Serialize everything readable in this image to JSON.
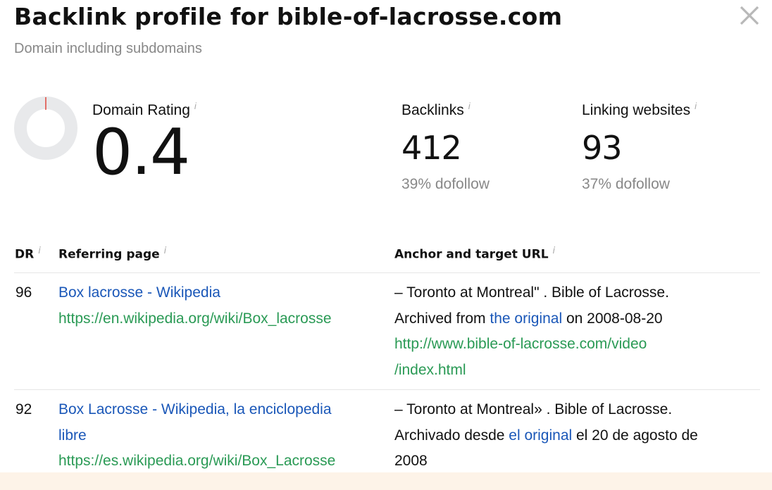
{
  "header": {
    "title": "Backlink profile for bible-of-lacrosse.com",
    "subtitle": "Domain including subdomains",
    "close_icon": "close-icon"
  },
  "metrics": {
    "domain_rating": {
      "label": "Domain Rating",
      "value": "0.4",
      "fraction": 0.004
    },
    "backlinks": {
      "label": "Backlinks",
      "value": "412",
      "dofollow": "39% dofollow"
    },
    "linking_websites": {
      "label": "Linking websites",
      "value": "93",
      "dofollow": "37% dofollow"
    },
    "info_glyph": "i"
  },
  "table": {
    "headers": {
      "dr": "DR",
      "referring_page": "Referring page",
      "anchor": "Anchor and target URL"
    },
    "rows": [
      {
        "dr": "96",
        "page_title": "Box lacrosse - Wikipedia",
        "page_url": "https://en.wikipedia.org/wiki/Box_lacrosse",
        "anchor_before_1": "– Toronto at Montreal\" . Bible of Lacrosse.",
        "anchor_before_2": "Archived from ",
        "anchor_link": "the original",
        "anchor_after": " on 2008-08-20",
        "target_url_1": "http://www.bible-of-lacrosse.com/video",
        "target_url_2": "/index.html"
      },
      {
        "dr": "92",
        "page_title_1": "Box Lacrosse - Wikipedia, la enciclopedia",
        "page_title_2": "libre",
        "page_url": "https://es.wikipedia.org/wiki/Box_Lacrosse",
        "anchor_before_1": "– Toronto at Montreal» . Bible of Lacrosse.",
        "anchor_before_2": "Archivado desde ",
        "anchor_link": "el original",
        "anchor_after": " el 20 de agosto de",
        "anchor_after_2": "2008"
      }
    ]
  },
  "colors": {
    "link": "#1a57b8",
    "url": "#2a9a55",
    "donut_track": "#e8e9eb",
    "donut_fill": "#e0463c"
  }
}
